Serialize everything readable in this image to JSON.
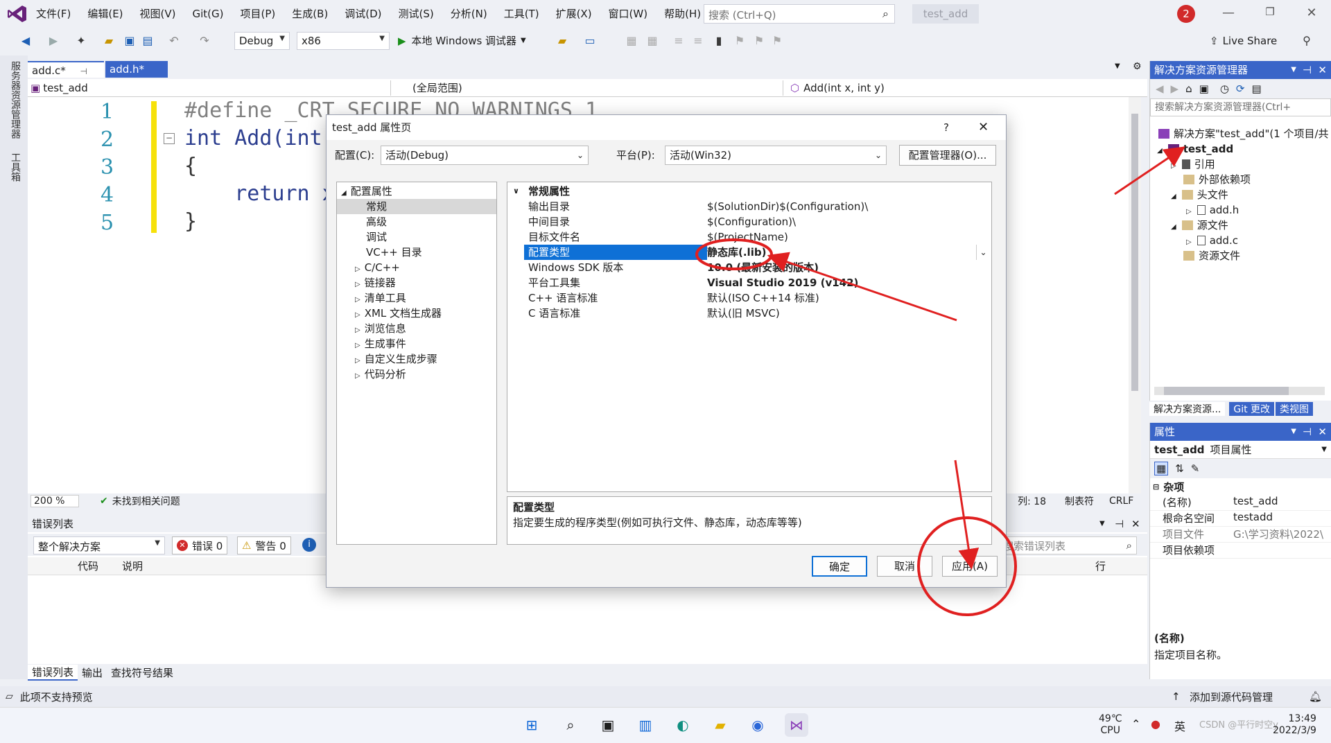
{
  "menubar": {
    "items": [
      "文件(F)",
      "编辑(E)",
      "视图(V)",
      "Git(G)",
      "项目(P)",
      "生成(B)",
      "调试(D)",
      "测试(S)",
      "分析(N)",
      "工具(T)",
      "扩展(X)",
      "窗口(W)",
      "帮助(H)"
    ],
    "search_placeholder": "搜索 (Ctrl+Q)",
    "project_title": "test_add",
    "notification_count": "2"
  },
  "toolbar": {
    "config": "Debug",
    "platform": "x86",
    "debugger_label": "本地 Windows 调试器",
    "live_share": "Live Share"
  },
  "left_tabs": [
    "服务器资源管理器",
    "工具箱"
  ],
  "editor": {
    "tabs": [
      "add.c*",
      "add.h*"
    ],
    "nav_project": "test_add",
    "nav_scope": "(全局范围)",
    "nav_member": "Add(int x, int y)",
    "line_numbers": [
      "1",
      "2",
      "3",
      "4",
      "5"
    ],
    "code_lines": [
      "#define _CRT_SECURE_NO_WARNINGS 1",
      "int Add(int x",
      "{",
      "    return x",
      "}"
    ],
    "zoom": "200 %",
    "issues": "未找到相关问题",
    "col": "列: 18",
    "tabs_mode": "制表符",
    "line_ending": "CRLF"
  },
  "error_list": {
    "title": "错误列表",
    "scope": "整个解决方案",
    "errors": "错误 0",
    "warnings": "警告 0",
    "search_placeholder": "搜索错误列表",
    "col_code": "代码",
    "col_desc": "说明",
    "col_line": "行",
    "bottom_tabs": [
      "错误列表",
      "输出",
      "查找符号结果"
    ]
  },
  "status_bar": {
    "left": "此项不支持预览",
    "right": "添加到源代码管理"
  },
  "solution_explorer": {
    "title": "解决方案资源管理器",
    "search_placeholder": "搜索解决方案资源管理器(Ctrl+",
    "solution": "解决方案\"test_add\"(1 个项目/共",
    "project": "test_add",
    "nodes": [
      "引用",
      "外部依赖项",
      "头文件",
      "add.h",
      "源文件",
      "add.c",
      "资源文件"
    ],
    "tabs": [
      "解决方案资源...",
      "Git 更改",
      "类视图"
    ]
  },
  "properties": {
    "title": "属性",
    "object": "test_add",
    "object_type": "项目属性",
    "category": "杂项",
    "rows": [
      {
        "name": "(名称)",
        "value": "test_add"
      },
      {
        "name": "根命名空间",
        "value": "testadd"
      },
      {
        "name": "项目文件",
        "value": "G:\\学习资料\\2022\\"
      },
      {
        "name": "项目依赖项",
        "value": ""
      }
    ],
    "desc_title": "(名称)",
    "desc_text": "指定项目名称。"
  },
  "dialog": {
    "title": "test_add 属性页",
    "help": "?",
    "config_label": "配置(C):",
    "config_value": "活动(Debug)",
    "platform_label": "平台(P):",
    "platform_value": "活动(Win32)",
    "config_manager": "配置管理器(O)...",
    "tree_root": "配置属性",
    "tree_children": [
      "常规",
      "高级",
      "调试",
      "VC++ 目录"
    ],
    "tree_groups": [
      "C/C++",
      "链接器",
      "清单工具",
      "XML 文档生成器",
      "浏览信息",
      "生成事件",
      "自定义生成步骤",
      "代码分析"
    ],
    "section": "常规属性",
    "props": [
      {
        "name": "输出目录",
        "value": "$(SolutionDir)$(Configuration)\\"
      },
      {
        "name": "中间目录",
        "value": "$(Configuration)\\"
      },
      {
        "name": "目标文件名",
        "value": "$(ProjectName)"
      },
      {
        "name": "配置类型",
        "value": "静态库(.lib)"
      },
      {
        "name": "Windows SDK 版本",
        "value": "10.0 (最新安装的版本)"
      },
      {
        "name": "平台工具集",
        "value": "Visual Studio 2019 (v142)"
      },
      {
        "name": "C++ 语言标准",
        "value": "默认(ISO C++14 标准)"
      },
      {
        "name": "C 语言标准",
        "value": "默认(旧 MSVC)"
      }
    ],
    "desc_title": "配置类型",
    "desc_text": "指定要生成的程序类型(例如可执行文件、静态库，动态库等等)",
    "ok": "确定",
    "cancel": "取消",
    "apply": "应用(A)"
  },
  "taskbar": {
    "temp": "49℃",
    "temp_label": "CPU",
    "ime": "英",
    "time": "13:49",
    "date": "2022/3/9",
    "watermark": "CSDN @平行时空y"
  },
  "colors": {
    "accent": "#3a65c8",
    "selection": "#0e70d6",
    "annotation": "#e02020"
  }
}
